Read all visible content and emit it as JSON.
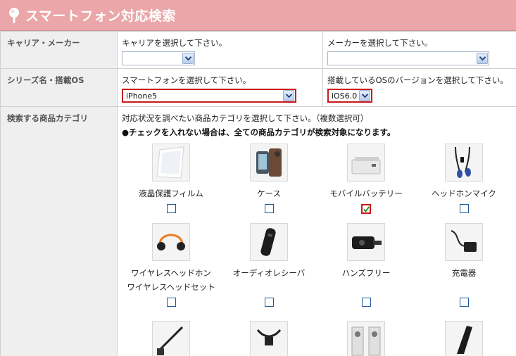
{
  "header": {
    "title": "スマートフォン対応検索",
    "icon": "search-magnifier-icon"
  },
  "rows": {
    "carrier": {
      "label": "キャリア・メーカー",
      "carrier_prompt": "キャリアを選択して下さい。",
      "carrier_value": "",
      "maker_prompt": "メーカーを選択して下さい。",
      "maker_value": ""
    },
    "series": {
      "label": "シリーズ名・搭載OS",
      "phone_prompt": "スマートフォンを選択して下さい。",
      "phone_value": "iPhone5",
      "os_prompt": "搭載しているOSのバージョンを選択して下さい。",
      "os_value": "iOS6.0"
    },
    "category": {
      "label": "検索する商品カテゴリ",
      "instruction": "対応状況を調べたい商品カテゴリを選択して下さい。（複数選択可）",
      "note": "●チェックを入れない場合は、全ての商品カテゴリが検索対象になります。",
      "items": [
        {
          "label": "液晶保護フィルム",
          "label2": "",
          "checked": false
        },
        {
          "label": "ケース",
          "label2": "",
          "checked": false
        },
        {
          "label": "モバイルバッテリー",
          "label2": "",
          "checked": true
        },
        {
          "label": "ヘッドホンマイク",
          "label2": "",
          "checked": false
        },
        {
          "label": "ワイヤレスヘッドホン",
          "label2": "ワイヤレスヘッドセット",
          "checked": false
        },
        {
          "label": "オーディオレシーバ",
          "label2": "",
          "checked": false
        },
        {
          "label": "ハンズフリー",
          "label2": "",
          "checked": false
        },
        {
          "label": "充電器",
          "label2": "",
          "checked": false
        }
      ]
    }
  },
  "colors": {
    "header_bg": "#eaa6a8",
    "highlight_red": "#cc1a1a",
    "label_bg": "#efefef"
  }
}
